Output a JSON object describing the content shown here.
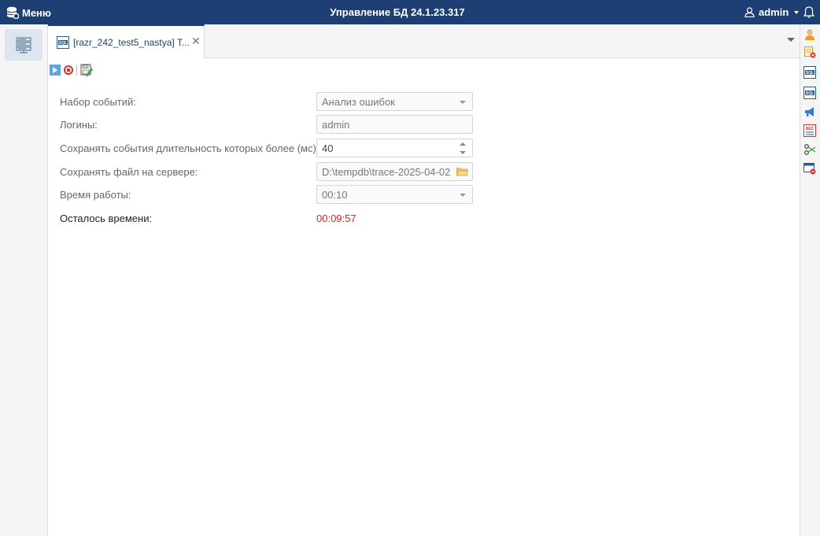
{
  "topbar": {
    "menu_label": "Меню",
    "title": "Управление БД 24.1.23.317",
    "user_label": "admin"
  },
  "tab": {
    "label": "[razr_242_test5_nastya] T..."
  },
  "form": {
    "event_set": {
      "label": "Набор событий:",
      "value": "Анализ ошибок"
    },
    "logins": {
      "label": "Логины:",
      "value": "admin"
    },
    "duration": {
      "label": "Сохранять события длительность которых более (мс):",
      "value": "40"
    },
    "server_file": {
      "label": "Сохранять файл на сервере:",
      "value": "D:\\tempdb\\trace-2025-04-02"
    },
    "run_time": {
      "label": "Время работы:",
      "value": "00:10"
    },
    "time_left": {
      "label": "Осталось времени:",
      "value": "00:09:57"
    }
  },
  "icons": {
    "menu": "database-gear-icon",
    "user": "user-icon",
    "bell": "bell-icon",
    "tab": "sql-icon",
    "play": "play-icon",
    "stop": "stop-icon",
    "save": "save-edit-icon",
    "folder": "folder-icon",
    "right_toolbar": [
      "person-icon",
      "doc-error-icon",
      "sql-icon",
      "sql-icon",
      "megaphone-icon",
      "rec-icon",
      "scissors-icon",
      "window-remove-icon"
    ]
  },
  "colors": {
    "topbar": "#1d3f73",
    "remaining_time": "#e02020",
    "play": "#5aa7df",
    "stop": "#d9302c"
  }
}
